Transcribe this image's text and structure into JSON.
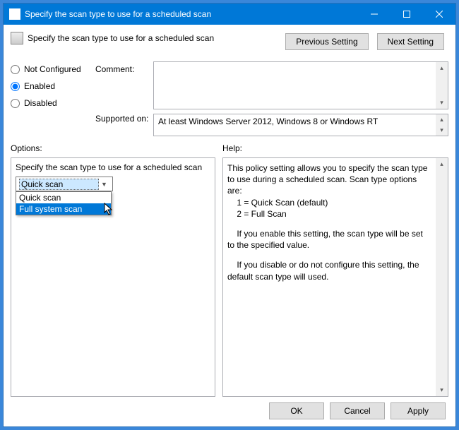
{
  "window": {
    "title": "Specify the scan type to use for a scheduled scan"
  },
  "header": {
    "title": "Specify the scan type to use for a scheduled scan",
    "previous": "Previous Setting",
    "next": "Next Setting"
  },
  "radios": {
    "not_configured": "Not Configured",
    "enabled": "Enabled",
    "disabled": "Disabled",
    "selected": "enabled"
  },
  "labels": {
    "comment": "Comment:",
    "supported": "Supported on:",
    "options": "Options:",
    "help": "Help:"
  },
  "supported_text": "At least Windows Server 2012, Windows 8 or Windows RT",
  "options_panel": {
    "label": "Specify the scan type to use for a scheduled scan",
    "selected": "Quick scan",
    "items": [
      "Quick scan",
      "Full system scan"
    ],
    "highlight_index": 1
  },
  "help_panel": {
    "line1": "This policy setting allows you to specify the scan type to use during a scheduled scan. Scan type options are:",
    "line2": "    1 = Quick Scan (default)",
    "line3": "    2 = Full Scan",
    "line4": "    If you enable this setting, the scan type will be set to the specified value.",
    "line5": "    If you disable or do not configure this setting, the default scan type will used."
  },
  "footer": {
    "ok": "OK",
    "cancel": "Cancel",
    "apply": "Apply"
  }
}
